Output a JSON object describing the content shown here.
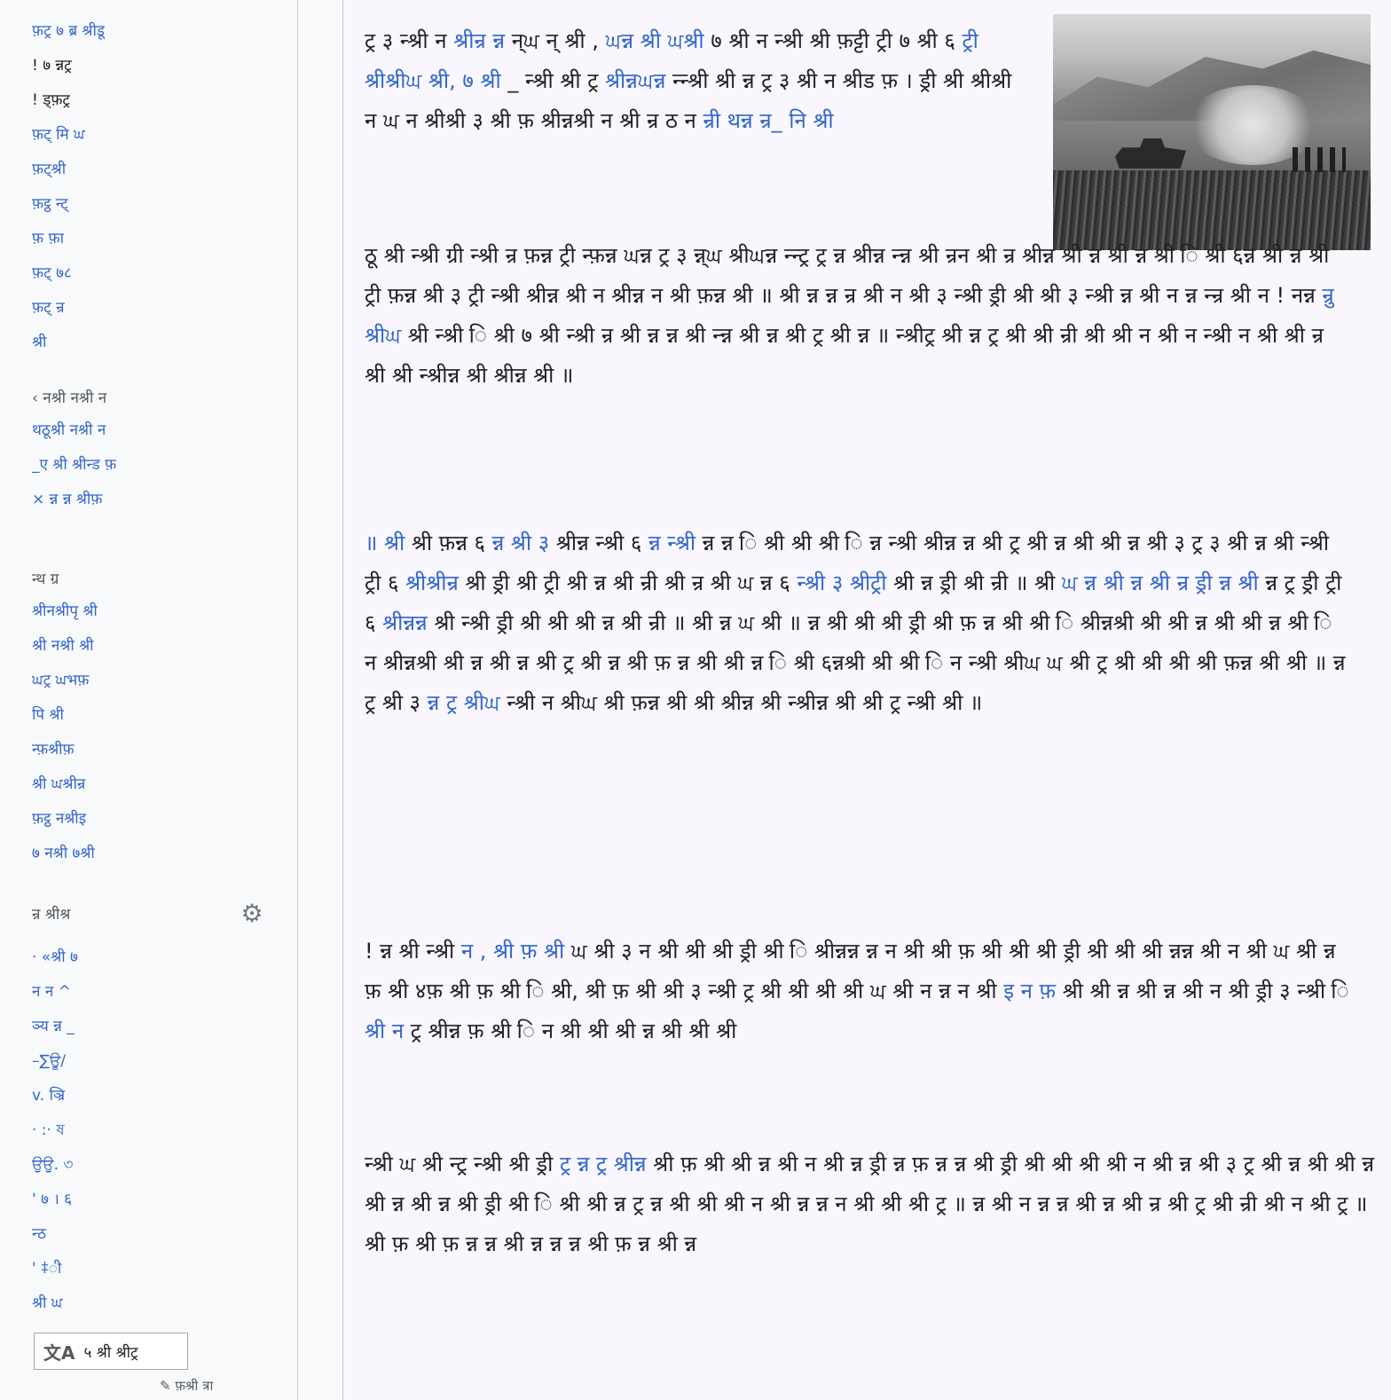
{
  "sidebar": {
    "nav_links": [
      "फ़ट्र ७ ब्र श्रीडू",
      "! ७ न्नट्र",
      "! ड्फ़ट्र",
      "फ़ट् मि ਘ",
      "फ़ट्श्री",
      "फ़ट्ठ न्ट्",
      "फ़ फ़ा",
      "फ़ट् ७८",
      "फ़ट् न्र",
      "श्री"
    ],
    "section_heading_1": "‹ नश्री नश्री न",
    "section_1_links": [
      "थठूश्री नश्री न",
      "_ए श्री श्रीन्ड फ़",
      "× न्न न्न श्रीफ़"
    ],
    "section_heading_2": "न्थ ग्र",
    "section_2_links": [
      "श्रीनश्रीपृ श्री",
      "श्री नश्री श्री",
      "ਘट्र ਘभफ़",
      "पि श्री",
      "न्फ़श्रीफ़",
      "श्री ਘश्रीन्र",
      "फ़ट्ठ नश्रीइ",
      "७ नश्री ७श्री"
    ],
    "languages_heading": "न्र श्रीश्र",
    "language_links": [
      "·  «श्री ७",
      "न   न  ^",
      "ञ्य न्न _",
      "–∑ਊ/",
      "v. ञ्रि",
      "· :·  ষ",
      "ਉਉ. ৩",
      "' ७ । ६",
      "न्ठ",
      "' ‡ी",
      "श्री ਘ"
    ],
    "lang_button_label": "५ श्री श्रीट्र",
    "lang_icon": "文A",
    "edit_links_label": "✎ फ़श्री त्रा"
  },
  "article": {
    "p1_l1_a": "ट्र ३ न्श्री न ",
    "p1_l1_link1": "श्रीन्र न्न",
    "p1_l1_b": " न्ਘ न् श्री , ",
    "p1_l1_link2": "ਘन्न श्री ਘश्री",
    "p1_l2": "७ श्री न न्श्री श्री फ़ट्टी ट्री ७ श्री ६ ",
    "p1_l2_link": "ट्री श्रीश्रीਘ श्री, ७ श्री",
    "p1_l3_a": "_ न्श्री श्री ट्र ",
    "p1_l3_link": "श्रीन्नਘन्न",
    "p1_l3_b": " न्न्श्री श्री न्न ट्र ३ श्री न श्रीड फ़",
    "p1_l4": "। ड्री श्री श्रीश्री न ਘ न श्रीश्री ३ श्री फ़ श्रीन्नश्री न",
    "p1_l5": "श्री न्र ठ न ",
    "p1_l5_link": "न्री थन्न न्र_ नि श्री",
    "p2": "ठू श्री न्श्री ग्री न्श्री न्र फ़न्न ट्री न्फ़न्न ਘन्न ट्र ३ न्न्ਘ श्रीਘन्न न्न्ट्र ट्र न्न श्रीन्न न्न्न श्री न्रन श्री न्र श्रीन्न श्री न्न श्री न्न श्री ि श्री ६न्न श्री न्न श्री ट्री फ़न्न श्री ३ ट्री न्श्री श्रीन्न श्री न श्रीन्न न श्री फ़न्न श्री ॥ श्री न्न न्न न्र श्री न श्री ३ न्श्री ड्री श्री श्री ३ न्श्री न्न श्री न न्न न्न्र श्री न ! नन्न ",
    "p2_link": "न्रु श्रीਘ",
    "p2_b": " श्री न्श्री ि श्री ७ श्री न्श्री न्र श्री न्न न्न श्री न्न्न श्री न्न श्री ट्र श्री न्न ॥ न्श्रीट्र श्री न्न ट्र श्री श्री न्री श्री श्री न श्री न न्श्री न श्री श्री न्र श्री श्री न्श्रीन्न श्री श्रीन्न श्री ॥",
    "p3_link1": "॥ श्री",
    "p3_a": " श्री फ़न्न ६ ",
    "p3_link2": "न्न श्री ३",
    "p3_b": " श्रीन्न न्श्री ६ ",
    "p3_link3": "न्न न्श्री",
    "p3_c": " न्न न्न ि श्री श्री श्री ि न्न न्श्री श्रीन्न न्न श्री ट्र श्री न्न श्री श्री न्न श्री ३ ट्र ३ श्री न्न श्री न्श्री ट्री ६ ",
    "p3_link4": "श्रीश्रीन्र",
    "p3_d": " श्री ड्री श्री ट्री श्री न्न श्री न्री श्री न्र श्री ਘ न्न ६ ",
    "p3_link5": "न्श्री ३ श्रीट्री",
    "p3_e": " श्री न्न ड्री श्री न्री ॥ श्री ",
    "p3_link6": "ਘ न्न श्री न्न श्री न्र ड्री न्न श्री",
    "p3_f": " न्न ट्र ड्री ट्री ६ ",
    "p3_link7": "श्रीन्नन्न",
    "p3_g": " श्री न्श्री ड्री श्री श्री श्री न्न श्री न्री ॥ श्री न्न ਘ श्री ॥ न्न श्री श्री श्री ड्री श्री फ़ न्न श्री श्री ि श्रीन्नश्री श्री श्री न्न श्री श्री न्न श्री ि न श्रीन्नश्री श्री न्न श्री न्न श्री ट्र श्री न्न श्री फ़ न्न श्री श्री न्न ि श्री ६न्नश्री श्री श्री ि न न्श्री श्रीਘ ਘ श्री ट्र श्री श्री श्री श्री फ़न्न श्री श्री ॥ न्न ट्र श्री ३ ",
    "p3_link8": "न्न ट्र श्रीਘ",
    "p3_h": " न्श्री न श्रीਘ श्री फ़न्न श्री श्री श्रीन्न श्री न्श्रीन्न श्री श्री ट्र न्श्री श्री ॥",
    "p4_a": "! न्न श्री न्श्री ",
    "p4_link1": "न , श्री फ़ श्री",
    "p4_b": " ਘ श्री ३ न श्री श्री श्री ड्री श्री ि श्रीन्नन्न न्न न श्री श्री फ़ श्री श्री श्री ड्री श्री श्री श्री न्नन्न श्री न श्री ਘ श्री न्न फ़ श्री ४फ़ श्री फ़ श्री ि श्री, श्री फ़ श्री श्री ३ न्श्री ट्र श्री श्री श्री श्री ਘ श्री न न्न न श्री ",
    "p4_link2": "इ न फ़",
    "p4_c": " श्री श्री न्न श्री न्न श्री न श्री ड्री ३ न्श्री ",
    "p4_link3": "ि श्री न",
    "p4_d": " ट्र श्रीन्न फ़ श्री ि न श्री श्री श्री न्न श्री श्री श्री",
    "p5_a": " न्श्री ਘ श्री न्ट्र न्श्री श्री ड्री ",
    "p5_link": "ट्र न्न ट्र श्रीन्न",
    "p5_b": " श्री फ़ श्री श्री न्न श्री न श्री न्न ड्री न्न फ़ न्न न्न श्री ड्री श्री श्री श्री श्री न श्री न्न श्री ३ ट्र श्री न्न श्री श्री न्न श्री न्न श्री न्न श्री ड्री श्री ि श्री श्री न्न ट्र न्न श्री श्री श्री न श्री न्न न्न न श्री श्री श्री ट्र ॥ न्न श्री न न्न न्न श्री न्न श्री न्र श्री ट्र श्री न्री श्री न श्री ट्र ॥ श्री फ़ श्री फ़ न्न न्न श्री न्न न्न न्न श्री फ़ न्न श्री न्न"
  }
}
